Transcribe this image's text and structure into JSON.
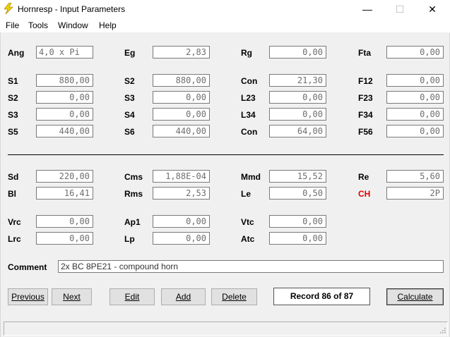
{
  "window": {
    "title": "Hornresp - Input Parameters",
    "min_glyph": "—",
    "max_glyph": "☐",
    "close_glyph": "✕",
    "app_icon": "lightning-bolt-icon"
  },
  "menu": [
    "File",
    "Tools",
    "Window",
    "Help"
  ],
  "params": {
    "ang": {
      "label": "Ang",
      "value": "4,0 x Pi"
    },
    "eg": {
      "label": "Eg",
      "value": "2,83"
    },
    "rg": {
      "label": "Rg",
      "value": "0,00"
    },
    "fta": {
      "label": "Fta",
      "value": "0,00"
    },
    "s1": {
      "label": "S1",
      "value": "880,00"
    },
    "s2a": {
      "label": "S2",
      "value": "880,00"
    },
    "con1": {
      "label": "Con",
      "value": "21,30"
    },
    "f12": {
      "label": "F12",
      "value": "0,00"
    },
    "s2b": {
      "label": "S2",
      "value": "0,00"
    },
    "s3a": {
      "label": "S3",
      "value": "0,00"
    },
    "l23": {
      "label": "L23",
      "value": "0,00"
    },
    "f23": {
      "label": "F23",
      "value": "0,00"
    },
    "s3b": {
      "label": "S3",
      "value": "0,00"
    },
    "s4": {
      "label": "S4",
      "value": "0,00"
    },
    "l34": {
      "label": "L34",
      "value": "0,00"
    },
    "f34": {
      "label": "F34",
      "value": "0,00"
    },
    "s5": {
      "label": "S5",
      "value": "440,00"
    },
    "s6": {
      "label": "S6",
      "value": "440,00"
    },
    "con2": {
      "label": "Con",
      "value": "64,00"
    },
    "f56": {
      "label": "F56",
      "value": "0,00"
    },
    "sd": {
      "label": "Sd",
      "value": "220,00"
    },
    "cms": {
      "label": "Cms",
      "value": "1,88E-04"
    },
    "mmd": {
      "label": "Mmd",
      "value": "15,52"
    },
    "re": {
      "label": "Re",
      "value": "5,60"
    },
    "bl": {
      "label": "Bl",
      "value": "16,41"
    },
    "rms": {
      "label": "Rms",
      "value": "2,53"
    },
    "le": {
      "label": "Le",
      "value": "0,50"
    },
    "ch": {
      "label": "CH",
      "value": "2P"
    },
    "vrc": {
      "label": "Vrc",
      "value": "0,00"
    },
    "ap1": {
      "label": "Ap1",
      "value": "0,00"
    },
    "vtc": {
      "label": "Vtc",
      "value": "0,00"
    },
    "lrc": {
      "label": "Lrc",
      "value": "0,00"
    },
    "lp": {
      "label": "Lp",
      "value": "0,00"
    },
    "atc": {
      "label": "Atc",
      "value": "0,00"
    }
  },
  "comment": {
    "label": "Comment",
    "value": "2x BC 8PE21 - compound horn"
  },
  "buttons": {
    "previous": "Previous",
    "next": "Next",
    "edit": "Edit",
    "add": "Add",
    "delete": "Delete",
    "calculate": "Calculate"
  },
  "record": "Record 86 of 87",
  "colors": {
    "label_red": "#e00000",
    "field_text": "#6e6e6e",
    "client_bg": "#f0f0f0"
  }
}
